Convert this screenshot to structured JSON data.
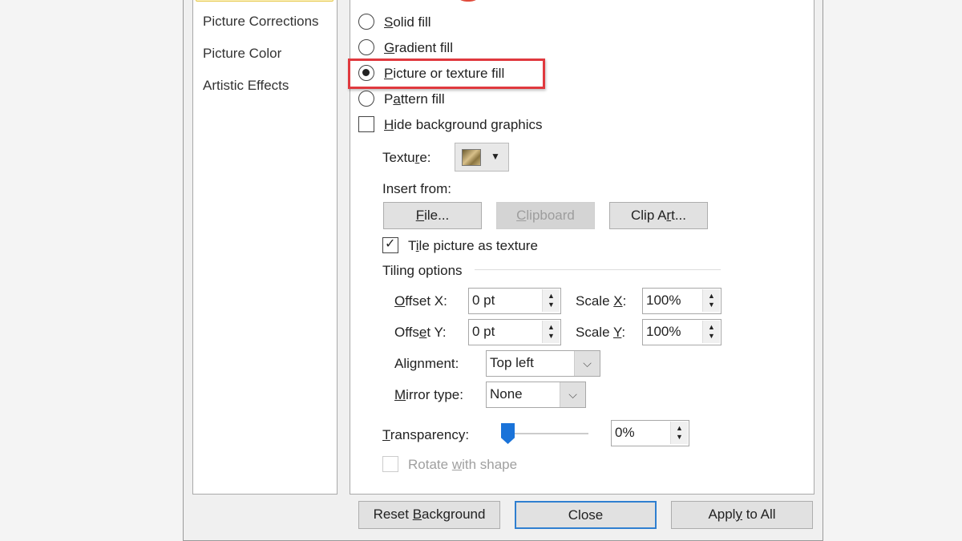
{
  "sidebar": {
    "items": [
      {
        "label": "Picture Corrections"
      },
      {
        "label": "Picture Color"
      },
      {
        "label": "Artistic Effects"
      }
    ]
  },
  "fill": {
    "options": [
      {
        "label": "Solid fill",
        "accel": "S",
        "selected": false
      },
      {
        "label": "Gradient fill",
        "accel": "G",
        "selected": false
      },
      {
        "label": "Picture or texture fill",
        "accel": "P",
        "selected": true
      },
      {
        "label": "Pattern fill",
        "accel": "a",
        "selected": false
      }
    ],
    "hide_bg": {
      "label": "Hide background graphics",
      "checked": false
    },
    "texture_label": "Texture:",
    "insert_from": "Insert from:",
    "file_btn": "File...",
    "clipboard_btn": "Clipboard",
    "clipart_btn": "Clip Art...",
    "tile": {
      "label": "Tile picture as texture",
      "checked": true
    },
    "tiling_options": "Tiling options",
    "offset_x_label": "Offset X:",
    "offset_x": "0 pt",
    "offset_y_label": "Offset Y:",
    "offset_y": "0 pt",
    "scale_x_label": "Scale X:",
    "scale_x": "100%",
    "scale_y_label": "Scale Y:",
    "scale_y": "100%",
    "alignment_label": "Alignment:",
    "alignment": "Top left",
    "mirror_label": "Mirror type:",
    "mirror": "None",
    "transparency_label": "Transparency:",
    "transparency": "0%",
    "transparency_value": 0,
    "rotate": {
      "label": "Rotate with shape",
      "checked": false,
      "disabled": true
    }
  },
  "footer": {
    "reset": "Reset Background",
    "close": "Close",
    "apply_all": "Apply to All"
  },
  "colors": {
    "highlight": "#e0393e",
    "slider": "#1a73d9",
    "close_border": "#2f7fd0"
  }
}
